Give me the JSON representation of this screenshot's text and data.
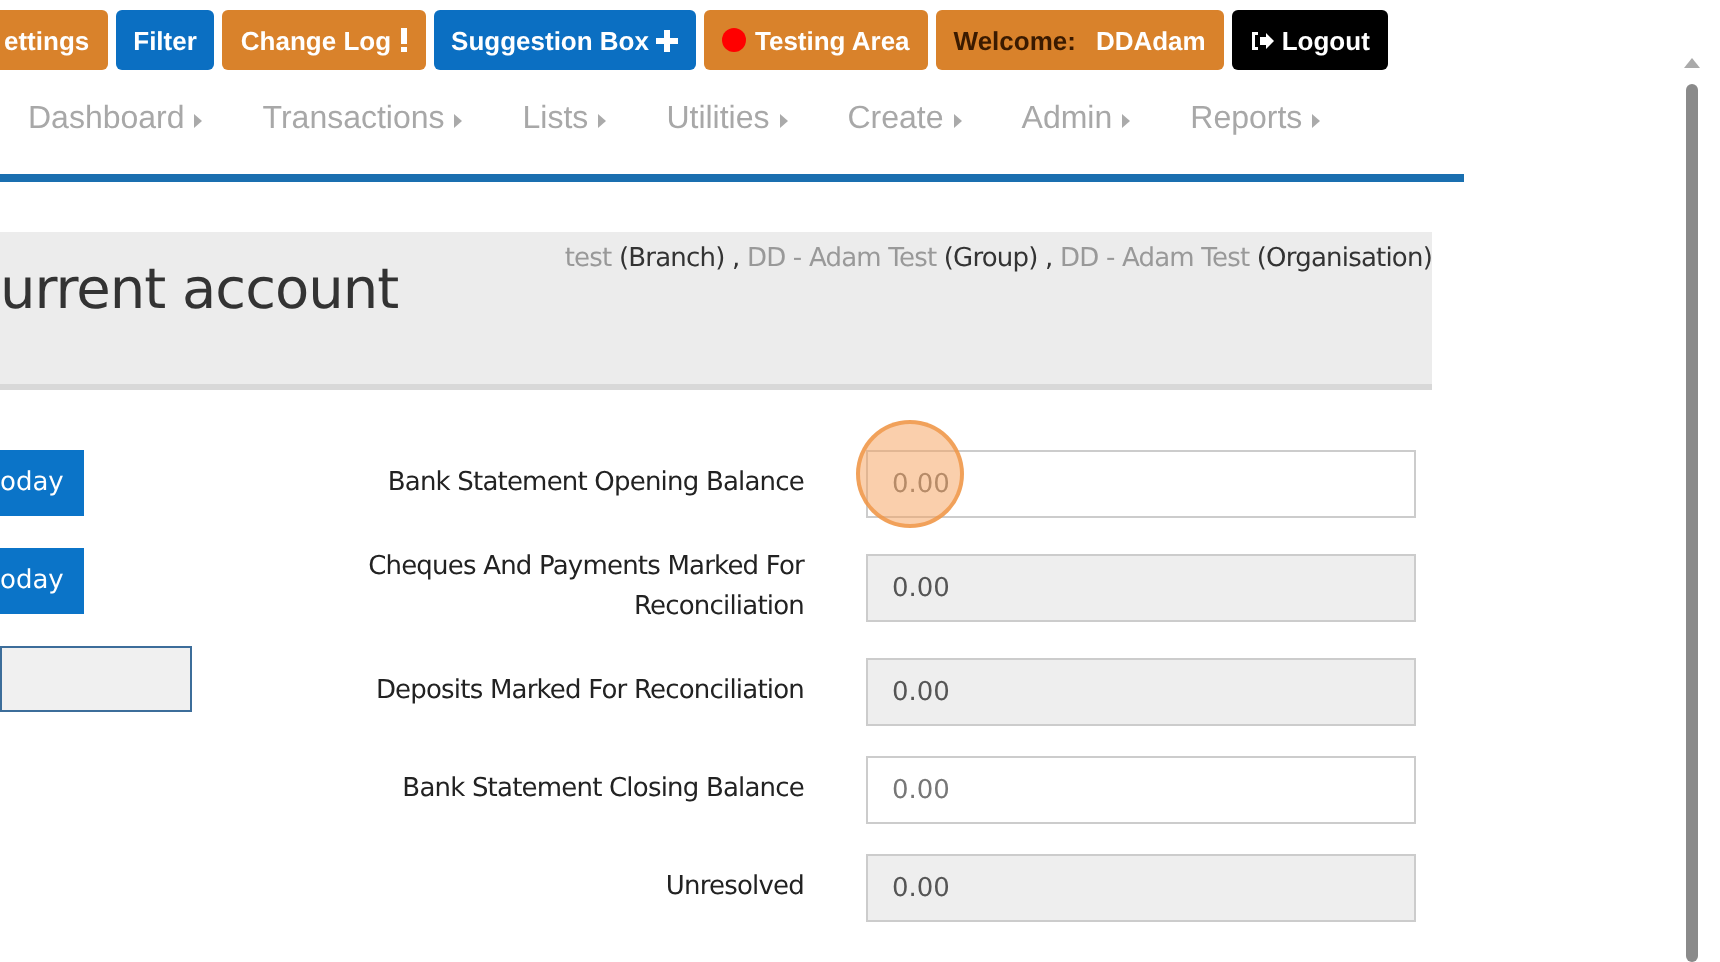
{
  "top_buttons": [
    {
      "label": "ettings",
      "color": "#d9822b",
      "kind": "plain"
    },
    {
      "label": "Filter",
      "color": "#0b6fc2",
      "kind": "plain"
    },
    {
      "label": "Change Log",
      "color": "#d9822b",
      "kind": "exclamation"
    },
    {
      "label": "Suggestion Box",
      "color": "#0b6fc2",
      "kind": "plus"
    },
    {
      "label": "Testing Area",
      "color": "#d9822b",
      "kind": "dot"
    },
    {
      "label": "Welcome:",
      "user": "DDAdam",
      "color": "#d9822b",
      "kind": "plain"
    },
    {
      "label": "Logout",
      "color": "#000000",
      "kind": "logout"
    }
  ],
  "nav": [
    "Dashboard",
    "Transactions",
    "Lists",
    "Utilities",
    "Create",
    "Admin",
    "Reports"
  ],
  "page_title": "urrent account",
  "breadcrumb": [
    {
      "name": "test",
      "scope": "(Branch)"
    },
    {
      "name": "DD - Adam Test",
      "scope": "(Group)"
    },
    {
      "name": "DD - Adam Test",
      "scope": "(Organisation)"
    }
  ],
  "breadcrumb_separator": ",",
  "side_buttons": [
    "oday",
    "oday"
  ],
  "fields": [
    {
      "label": "Bank Statement Opening Balance",
      "value": "0.00",
      "disabled": false,
      "clicked": true
    },
    {
      "label": "Cheques And Payments Marked For Reconciliation",
      "value": "0.00",
      "disabled": true
    },
    {
      "label": "Deposits Marked For Reconciliation",
      "value": "0.00",
      "disabled": true
    },
    {
      "label": "Bank Statement Closing Balance",
      "value": "0.00",
      "disabled": false
    },
    {
      "label": "Unresolved",
      "value": "0.00",
      "disabled": true
    }
  ]
}
